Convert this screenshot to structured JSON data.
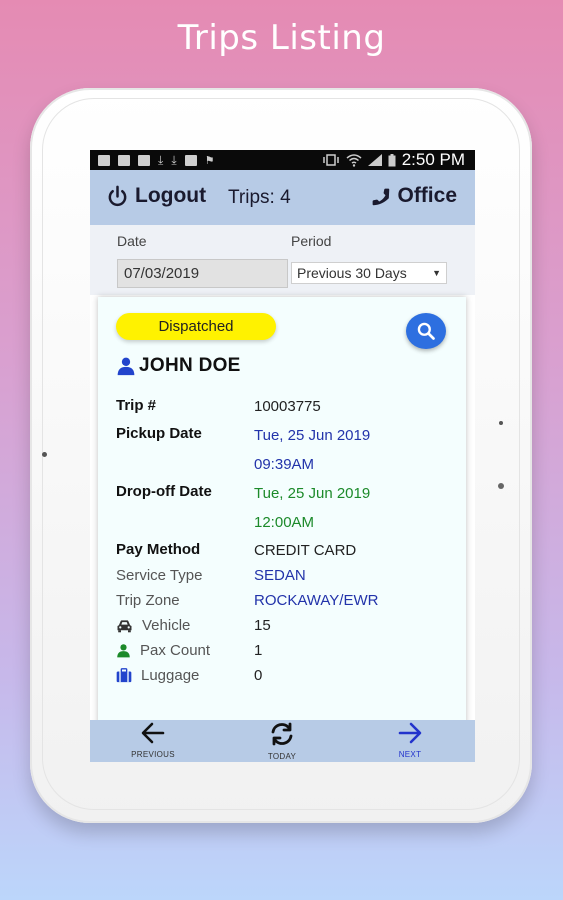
{
  "promo": {
    "title": "Trips Listing"
  },
  "statusbar": {
    "time": "2:50 PM"
  },
  "appbar": {
    "logout_label": "Logout",
    "trips_label": "Trips: 4",
    "office_label": "Office"
  },
  "filters": {
    "date_label": "Date",
    "date_value": "07/03/2019",
    "period_label": "Period",
    "period_value": "Previous 30 Days"
  },
  "trip": {
    "status": "Dispatched",
    "passenger_name": "JOHN DOE",
    "fields": {
      "trip_no_label": "Trip #",
      "trip_no": "10003775",
      "pickup_label": "Pickup Date",
      "pickup_date": "Tue, 25 Jun 2019",
      "pickup_time": "09:39AM",
      "dropoff_label": "Drop-off Date",
      "dropoff_date": "Tue, 25 Jun 2019",
      "dropoff_time": "12:00AM",
      "pay_label": "Pay Method",
      "pay_method": "CREDIT CARD",
      "service_label": "Service Type",
      "service_type": "SEDAN",
      "zone_label": "Trip Zone",
      "trip_zone": "ROCKAWAY/EWR",
      "vehicle_label": "Vehicle",
      "vehicle": "15",
      "pax_label": "Pax Count",
      "pax_count": "1",
      "luggage_label": "Luggage",
      "luggage": "0"
    }
  },
  "bottom_nav": {
    "previous": "PREVIOUS",
    "today": "TODAY",
    "next": "NEXT"
  },
  "colors": {
    "appbar": "#b7cbe6",
    "badge": "#fff200",
    "search_button": "#2d6fe0",
    "blue_text": "#2233aa",
    "green_text": "#1c8a2a",
    "card_bg": "#f4fefe"
  },
  "icons": {
    "logout": "power-icon",
    "office": "phone-icon",
    "search": "search-icon",
    "passenger": "person-icon",
    "vehicle": "car-icon",
    "pax": "person-icon",
    "luggage": "suitcase-icon",
    "previous": "arrow-left-icon",
    "today": "refresh-icon",
    "next": "arrow-right-icon"
  }
}
